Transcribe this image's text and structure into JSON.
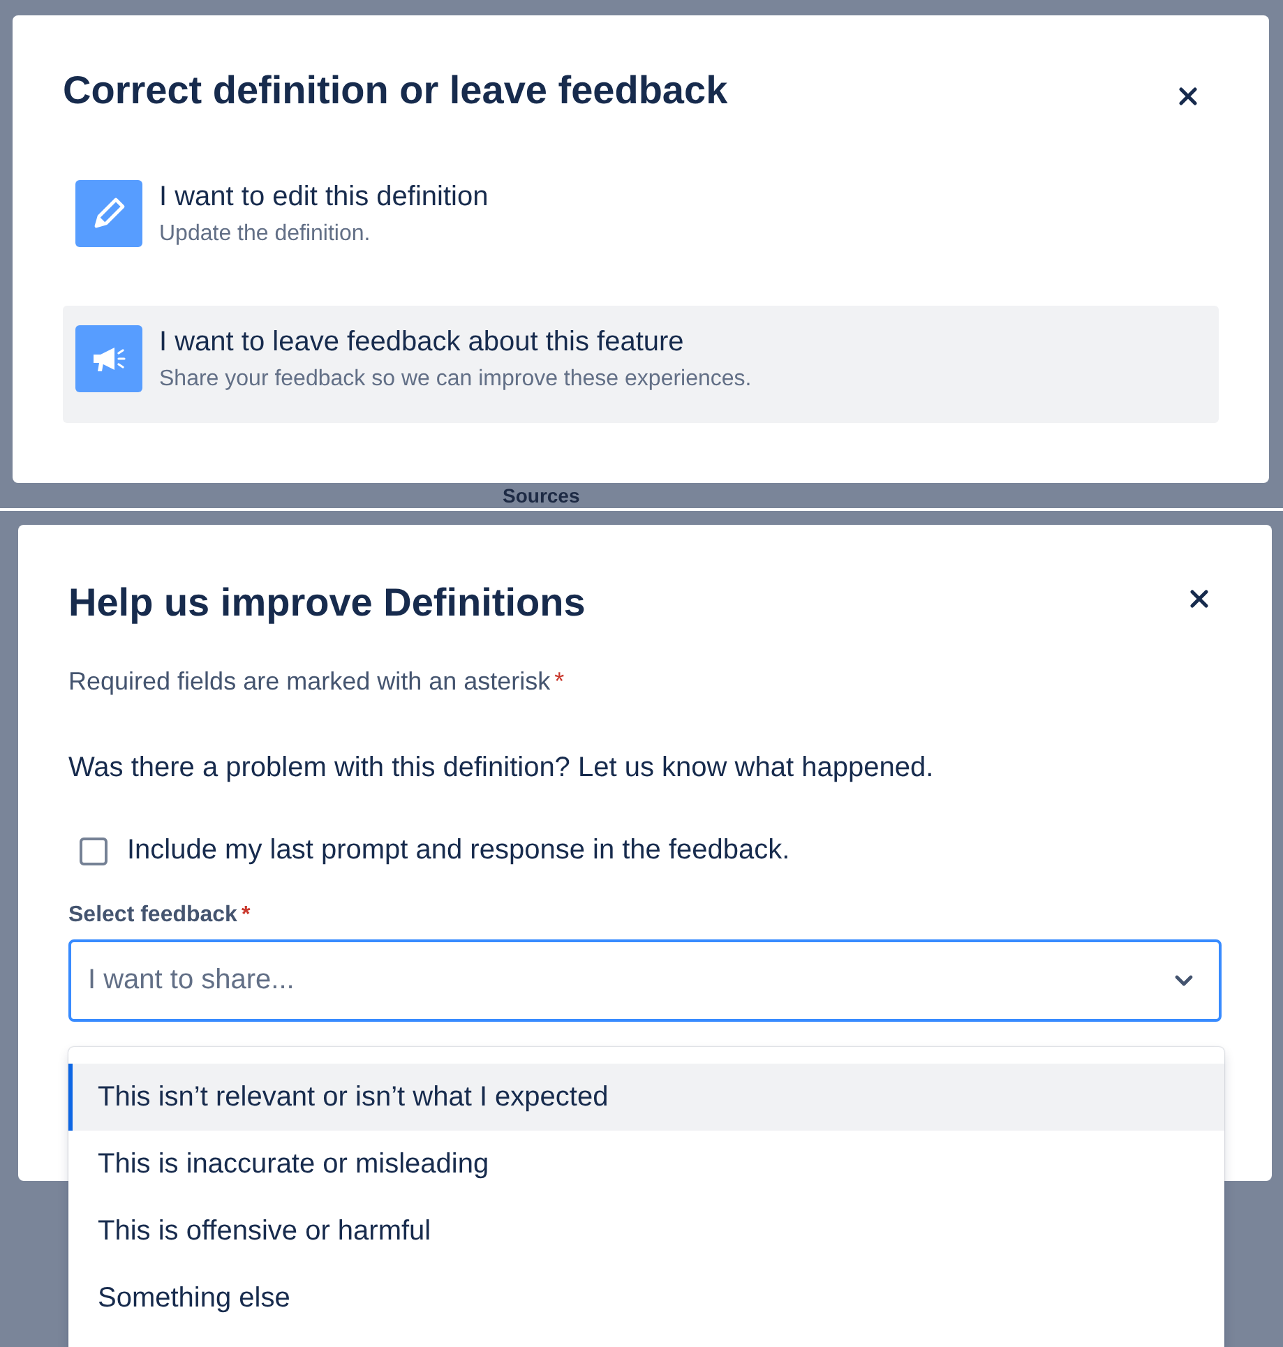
{
  "choice_dialog": {
    "title": "Correct definition or leave feedback",
    "options": [
      {
        "kind": "edit",
        "label": "I want to edit this definition",
        "description": "Update the definition.",
        "selected": false
      },
      {
        "kind": "feedback",
        "label": "I want to leave feedback about this feature",
        "description": "Share your feedback so we can improve these experiences.",
        "selected": true
      }
    ]
  },
  "backdrop": {
    "heading": "Sources"
  },
  "feedback_dialog": {
    "title": "Help us improve Definitions",
    "required_note": "Required fields are marked with an asterisk",
    "required_mark": "*",
    "question": "Was there a problem with this definition? Let us know what happened.",
    "include_checkbox": {
      "label": "Include my last prompt and response in the feedback.",
      "checked": false
    },
    "select": {
      "label": "Select feedback",
      "required_mark": "*",
      "placeholder": "I want to share...",
      "expanded": true,
      "options": [
        {
          "label": "This isn’t relevant or isn’t what I expected",
          "selected": true
        },
        {
          "label": "This is inaccurate or misleading",
          "selected": false
        },
        {
          "label": "This is offensive or harmful",
          "selected": false
        },
        {
          "label": "Something else",
          "selected": false
        }
      ]
    }
  }
}
